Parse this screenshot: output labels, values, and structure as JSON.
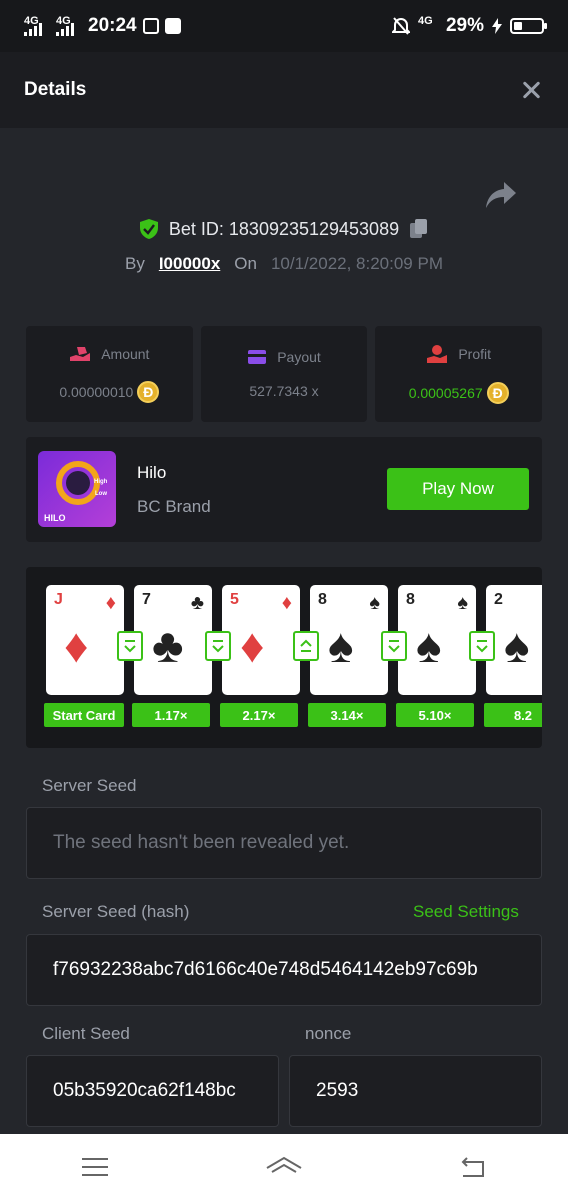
{
  "status_bar": {
    "net1": "4G",
    "net2": "4G",
    "time": "20:24",
    "net3": "4G",
    "battery_pct": "29%",
    "battery_level": 0.29
  },
  "header": {
    "title": "Details"
  },
  "bet": {
    "id": "Bet ID: 18309235129453089",
    "by_label": "By",
    "user": "I00000x",
    "on_label": "On",
    "date": "10/1/2022, 8:20:09 PM"
  },
  "stats": {
    "amount_label": "Amount",
    "amount_value": "0.00000010",
    "payout_label": "Payout",
    "payout_value": "527.7343 x",
    "profit_label": "Profit",
    "profit_value": "0.00005267",
    "coin_symbol": "Đ"
  },
  "game": {
    "name": "Hilo",
    "brand": "BC Brand",
    "play_label": "Play Now",
    "thumb_label": "HILO",
    "thumb_high": "High",
    "thumb_low": "Low"
  },
  "cards": [
    {
      "rank": "J",
      "suit": "♦",
      "color": "red",
      "label": "Start Card"
    },
    {
      "rank": "7",
      "suit": "♣",
      "color": "black",
      "label": "1.17×",
      "dir": "down"
    },
    {
      "rank": "5",
      "suit": "♦",
      "color": "red",
      "label": "2.17×",
      "dir": "down"
    },
    {
      "rank": "8",
      "suit": "♠",
      "color": "black",
      "label": "3.14×",
      "dir": "up"
    },
    {
      "rank": "8",
      "suit": "♠",
      "color": "black",
      "label": "5.10×",
      "dir": "down"
    },
    {
      "rank": "2",
      "suit": "♠",
      "color": "black",
      "label": "8.2",
      "dir": "down"
    }
  ],
  "seeds": {
    "server_label": "Server Seed",
    "server_value": "The seed hasn't been revealed yet.",
    "hash_label": "Server Seed (hash)",
    "settings_label": "Seed Settings",
    "hash_value": "f76932238abc7d6166c40e748d5464142eb97c69b",
    "client_label": "Client Seed",
    "client_value": "05b35920ca62f148bc",
    "nonce_label": "nonce",
    "nonce_value": "2593"
  },
  "colors": {
    "accent": "#3bc117",
    "bg": "#24262b",
    "card_bg": "#1b1c20"
  }
}
